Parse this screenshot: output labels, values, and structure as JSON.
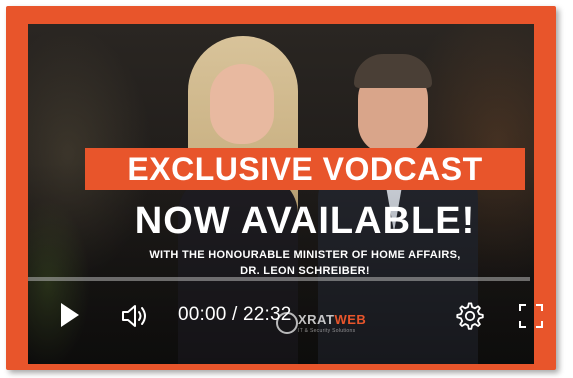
{
  "video": {
    "banner_text": "EXCLUSIVE VODCAST",
    "headline": "NOW AVAILABLE!",
    "subline_1": "WITH THE HONOURABLE MINISTER OF HOME AFFAIRS,",
    "subline_2": "DR. LEON SCHREIBER!",
    "logo_text_main": "XRAT",
    "logo_text_accent": "WEB",
    "logo_tagline": "IT & Security Solutions"
  },
  "player": {
    "time_display": "00:00 / 22:32",
    "progress_fraction": 0,
    "play_icon": "play-icon",
    "volume_icon": "volume-icon",
    "settings_icon": "gear-icon",
    "fullscreen_icon": "fullscreen-icon"
  },
  "colors": {
    "accent": "#e8552b",
    "frame": "#e8552b",
    "text": "#ffffff"
  }
}
